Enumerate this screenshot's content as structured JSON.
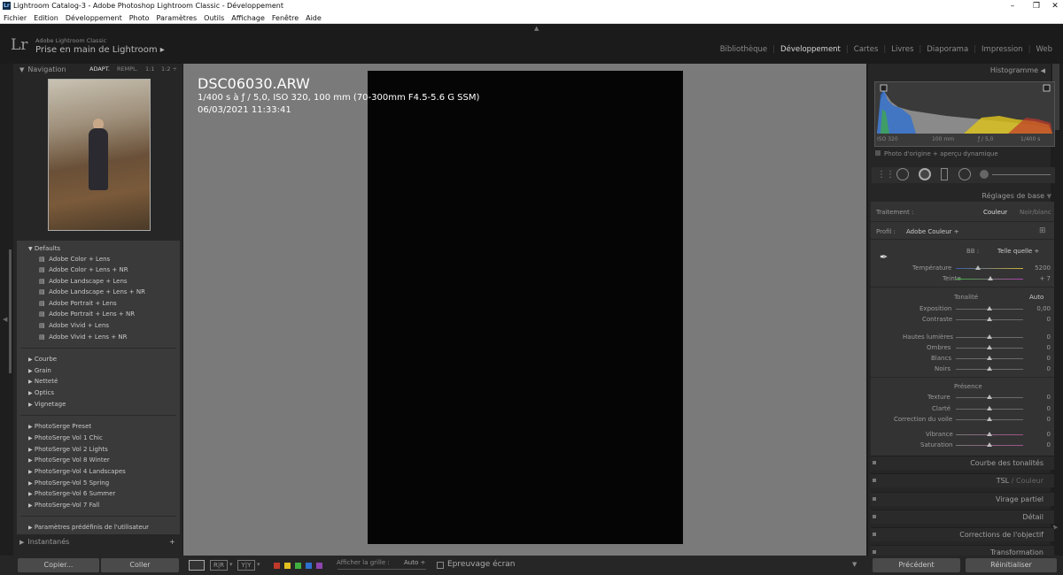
{
  "window": {
    "title": "Lightroom Catalog-3 - Adobe Photoshop Lightroom Classic - Développement",
    "minimize": "–",
    "restore": "❐",
    "close": "✕"
  },
  "menu": [
    "Fichier",
    "Edition",
    "Développement",
    "Photo",
    "Paramètres",
    "Outils",
    "Affichage",
    "Fenêtre",
    "Aide"
  ],
  "brand": {
    "logo": "Lr",
    "small": "Adobe Lightroom Classic",
    "large": "Prise en main de Lightroom  ▸"
  },
  "modules": {
    "items": [
      "Bibliothèque",
      "Développement",
      "Cartes",
      "Livres",
      "Diaporama",
      "Impression",
      "Web"
    ],
    "active": "Développement"
  },
  "navigator": {
    "title": "Navigation",
    "options": [
      "ADAPT.",
      "REMPL.",
      "1:1",
      "1:2 ÷"
    ]
  },
  "presets": {
    "defaults_group": "Defaults",
    "defaults": [
      "Adobe Color + Lens",
      "Adobe Color + Lens + NR",
      "Adobe Landscape + Lens",
      "Adobe Landscape + Lens + NR",
      "Adobe Portrait + Lens",
      "Adobe Portrait + Lens + NR",
      "Adobe Vivid + Lens",
      "Adobe Vivid + Lens + NR"
    ],
    "groups1": [
      "Courbe",
      "Grain",
      "Netteté",
      "Optics",
      "Vignetage"
    ],
    "groups2": [
      "PhotoSerge Preset",
      "PhotoSerge Vol 1 Chic",
      "PhotoSerge Vol 2 Lights",
      "PhotoSerge Vol 8 Winter",
      "PhotoSerge-Vol 4 Landscapes",
      "PhotoSerge-Vol 5 Spring",
      "PhotoSerge-Vol 6 Summer",
      "PhotoSerge-Vol 7 Fall"
    ],
    "user": "Paramètres prédéfinis de l'utilisateur"
  },
  "snapshots": {
    "title": "Instantanés",
    "add": "+"
  },
  "left_buttons": {
    "copy": "Copier...",
    "paste": "Coller"
  },
  "photo_overlay": {
    "filename": "DSC06030.ARW",
    "exposure": "1/400 s à ƒ / 5,0, ISO 320, 100 mm (70-300mm F4.5-5.6 G SSM)",
    "datetime": "06/03/2021 11:33:41"
  },
  "toolbar": {
    "grid_label": "Afficher la grille :",
    "grid_value": "Auto ÷",
    "proof_label": "Epreuvage écran"
  },
  "histogram": {
    "title": "Histogramme",
    "iso": "ISO 320",
    "focal": "100 mm",
    "aperture": "ƒ / 5,0",
    "shutter": "1/400 s",
    "preview": "Photo d'origine + aperçu dynamique"
  },
  "basic": {
    "title": "Réglages de base",
    "treatment_label": "Traitement :",
    "treatment_color": "Couleur",
    "treatment_bw": "Noir/blanc",
    "profile_label": "Profil :",
    "profile_value": "Adobe Couleur ÷",
    "wb_label": "BB :",
    "wb_value": "Telle quelle ÷",
    "temp_label": "Température",
    "temp_value": "5200",
    "tint_label": "Teinte",
    "tint_value": "+ 7",
    "tone_title": "Tonalité",
    "auto": "Auto",
    "exposure_label": "Exposition",
    "exposure_value": "0,00",
    "contrast_label": "Contraste",
    "contrast_value": "0",
    "highlights_label": "Hautes lumières",
    "highlights_value": "0",
    "shadows_label": "Ombres",
    "shadows_value": "0",
    "whites_label": "Blancs",
    "whites_value": "0",
    "blacks_label": "Noirs",
    "blacks_value": "0",
    "presence_title": "Présence",
    "texture_label": "Texture",
    "texture_value": "0",
    "clarity_label": "Clarté",
    "clarity_value": "0",
    "dehaze_label": "Correction du voile",
    "dehaze_value": "0",
    "vibrance_label": "Vibrance",
    "vibrance_value": "0",
    "saturation_label": "Saturation",
    "saturation_value": "0"
  },
  "sections": {
    "tone_curve": "Courbe des tonalités",
    "hsl": "TSL",
    "hsl_color": "Couleur",
    "split": "Virage partiel",
    "detail": "Détail",
    "lens": "Corrections de l'objectif",
    "transform": "Transformation"
  },
  "right_buttons": {
    "previous": "Précédent",
    "reset": "Réinitialiser"
  },
  "colors": {
    "accent": "#d8d8d8",
    "swatches": [
      "#c0392b",
      "#e0c020",
      "#3fae3f",
      "#2f6fd0",
      "#8e44ad"
    ]
  }
}
